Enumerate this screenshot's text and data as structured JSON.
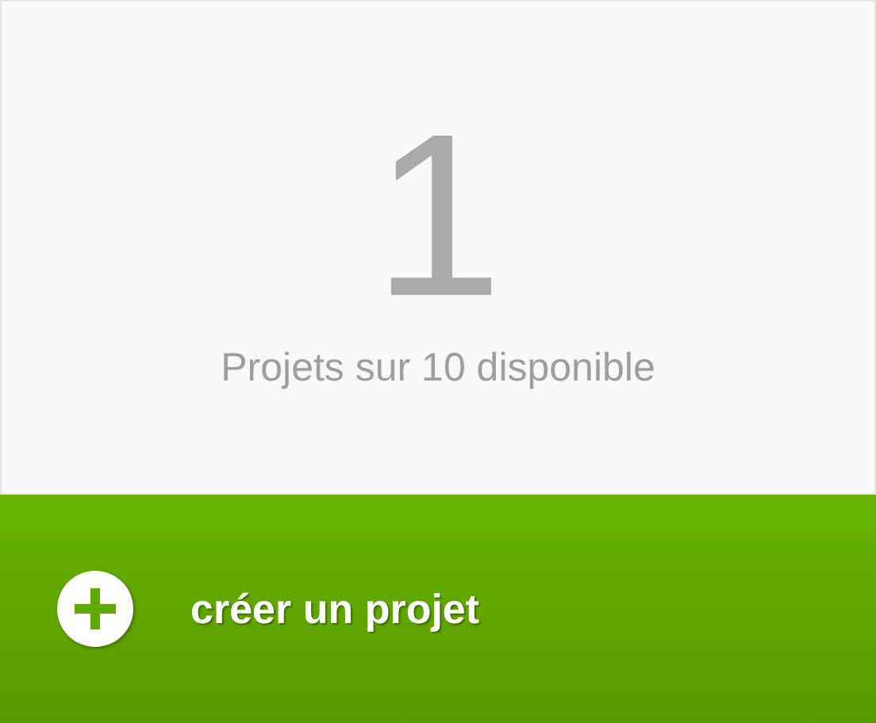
{
  "counter": {
    "value": "1",
    "caption": "Projets sur 10 disponible"
  },
  "create_button": {
    "label": "créer un projet"
  }
}
